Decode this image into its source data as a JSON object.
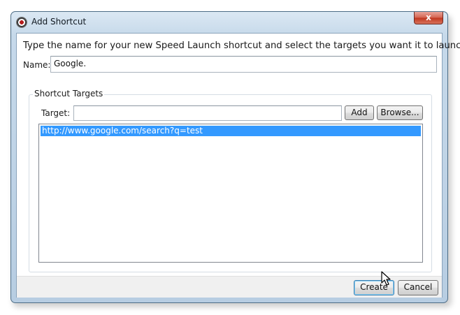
{
  "window": {
    "title": "Add Shortcut",
    "close_glyph": "x"
  },
  "dialog": {
    "instructions": "Type the name for your new Speed Launch shortcut and select the targets you want it to launch.",
    "name_label": "Name:",
    "name_value": "Google."
  },
  "targets": {
    "group_title": "Shortcut Targets",
    "target_label": "Target:",
    "target_value": "",
    "add_label": "Add",
    "browse_label": "Browse...",
    "items": [
      {
        "text": "http://www.google.com/search?q=test",
        "selected": true
      }
    ]
  },
  "footer": {
    "create_label": "Create",
    "cancel_label": "Cancel"
  },
  "colors": {
    "selection": "#3399ff",
    "close_button": "#c0361f",
    "title_bar": "#c6d9ea"
  },
  "icons": {
    "app": "speed-launch-icon",
    "close": "close-icon",
    "cursor": "mouse-pointer-icon"
  }
}
